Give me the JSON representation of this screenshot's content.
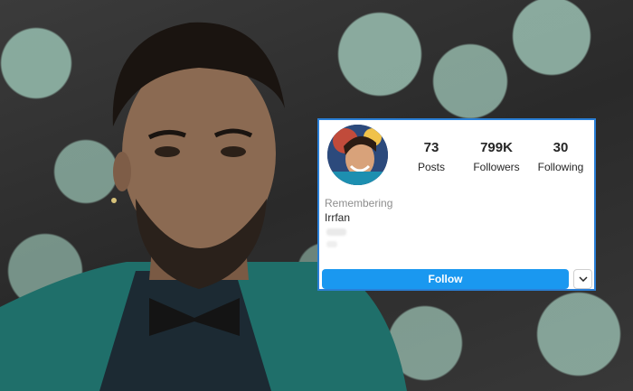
{
  "profile": {
    "stats": [
      {
        "value": "73",
        "label": "Posts"
      },
      {
        "value": "799K",
        "label": "Followers"
      },
      {
        "value": "30",
        "label": "Following"
      }
    ],
    "bio_line1": "Remembering",
    "bio_line2": "Irrfan",
    "follow_label": "Follow",
    "more_icon": "chevron-down-icon"
  },
  "colors": {
    "accent": "#1a98f0",
    "card_border": "#2a7fd6"
  }
}
